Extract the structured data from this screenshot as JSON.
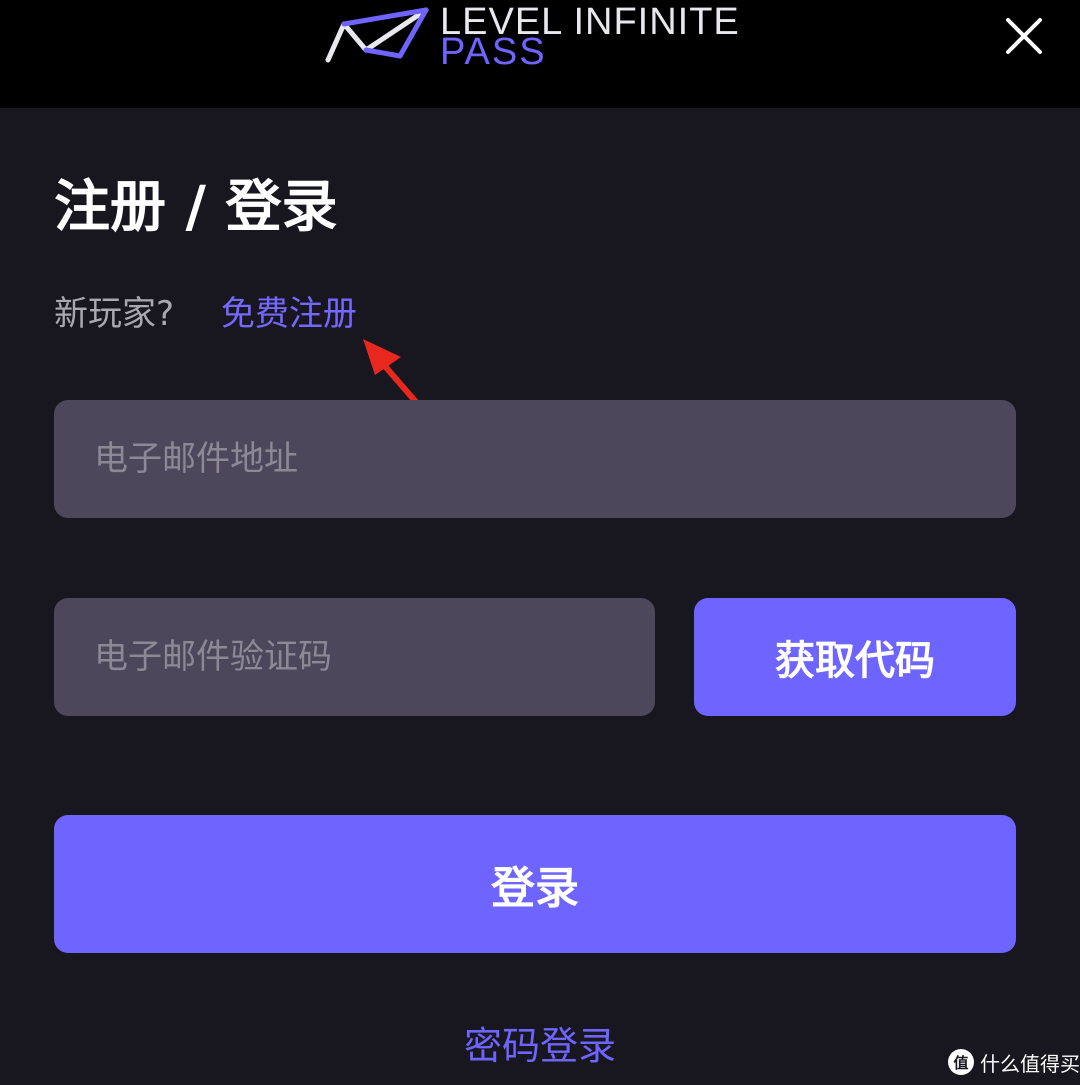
{
  "header": {
    "brand_line1": "LEVEL INFINITE",
    "brand_line2": "PASS"
  },
  "form": {
    "title": "注册 / 登录",
    "new_player_question": "新玩家?",
    "register_link": "免费注册",
    "email_placeholder": "电子邮件地址",
    "code_placeholder": "电子邮件验证码",
    "get_code_label": "获取代码",
    "login_label": "登录",
    "password_login_label": "密码登录"
  },
  "watermark": {
    "badge": "值",
    "text": "什么值得买"
  },
  "colors": {
    "background": "#18161e",
    "header": "#000000",
    "accent": "#6e64ff",
    "field": "#4c475a",
    "annotation_arrow": "#e8281e"
  },
  "icons": {
    "logo": "level-infinite-logo-icon",
    "close": "close-icon",
    "arrow": "annotation-arrow-icon"
  }
}
